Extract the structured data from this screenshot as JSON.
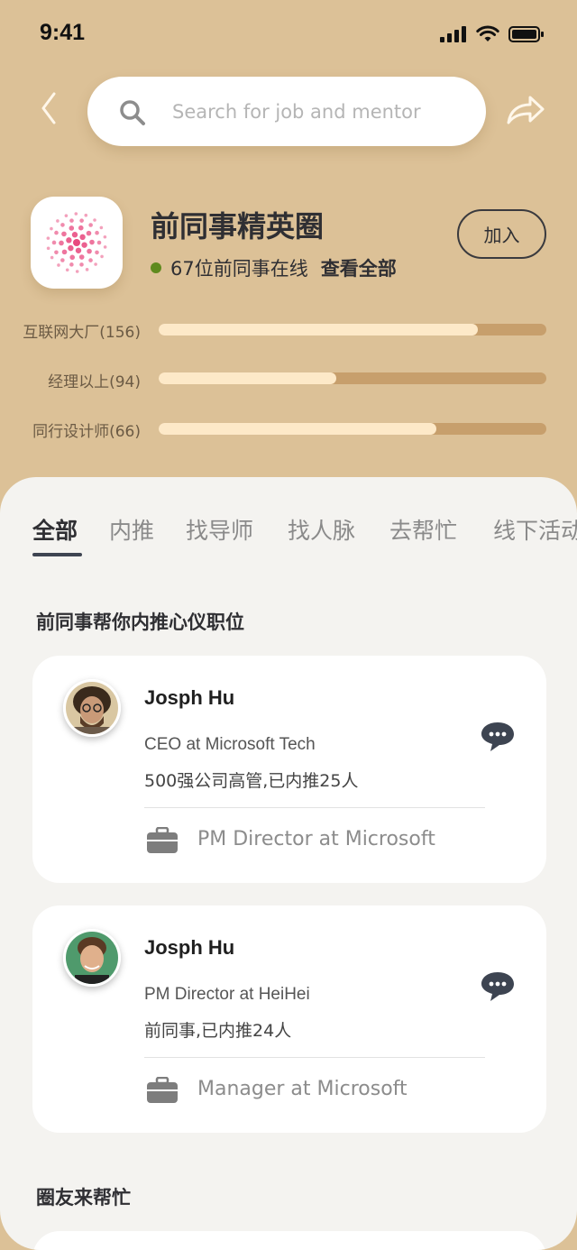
{
  "status_bar": {
    "time": "9:41"
  },
  "header": {
    "search_placeholder": "Search for job and mentor"
  },
  "group": {
    "title": "前同事精英圈",
    "online_text": "67位前同事在线",
    "view_all": "查看全部",
    "join_label": "加入"
  },
  "stats": [
    {
      "label": "互联网大厂(156)",
      "fill": 0.824
    },
    {
      "label": "经理以上(94)",
      "fill": 0.458
    },
    {
      "label": "同行设计师(66)",
      "fill": 0.716
    }
  ],
  "tabs": [
    "全部",
    "内推",
    "找导师",
    "找人脉",
    "去帮忙",
    "线下活动"
  ],
  "section_referral": "前同事帮你内推心仪职位",
  "cards": [
    {
      "name": "Josph Hu",
      "role": "CEO at Microsoft Tech",
      "desc": "500强公司高管,已内推25人",
      "job": "PM Director at Microsoft"
    },
    {
      "name": "Josph Hu",
      "role": "PM Director at HeiHei",
      "desc": "前同事,已内推24人",
      "job": "Manager at Microsoft"
    }
  ],
  "section_help": "圈友来帮忙",
  "colors": {
    "header_bg": "#dcc197",
    "bar_track": "#c79f6c",
    "bar_fill": "#fde9c8",
    "online_dot": "#5f8a1e",
    "logo_accent": "#e84a7f"
  }
}
